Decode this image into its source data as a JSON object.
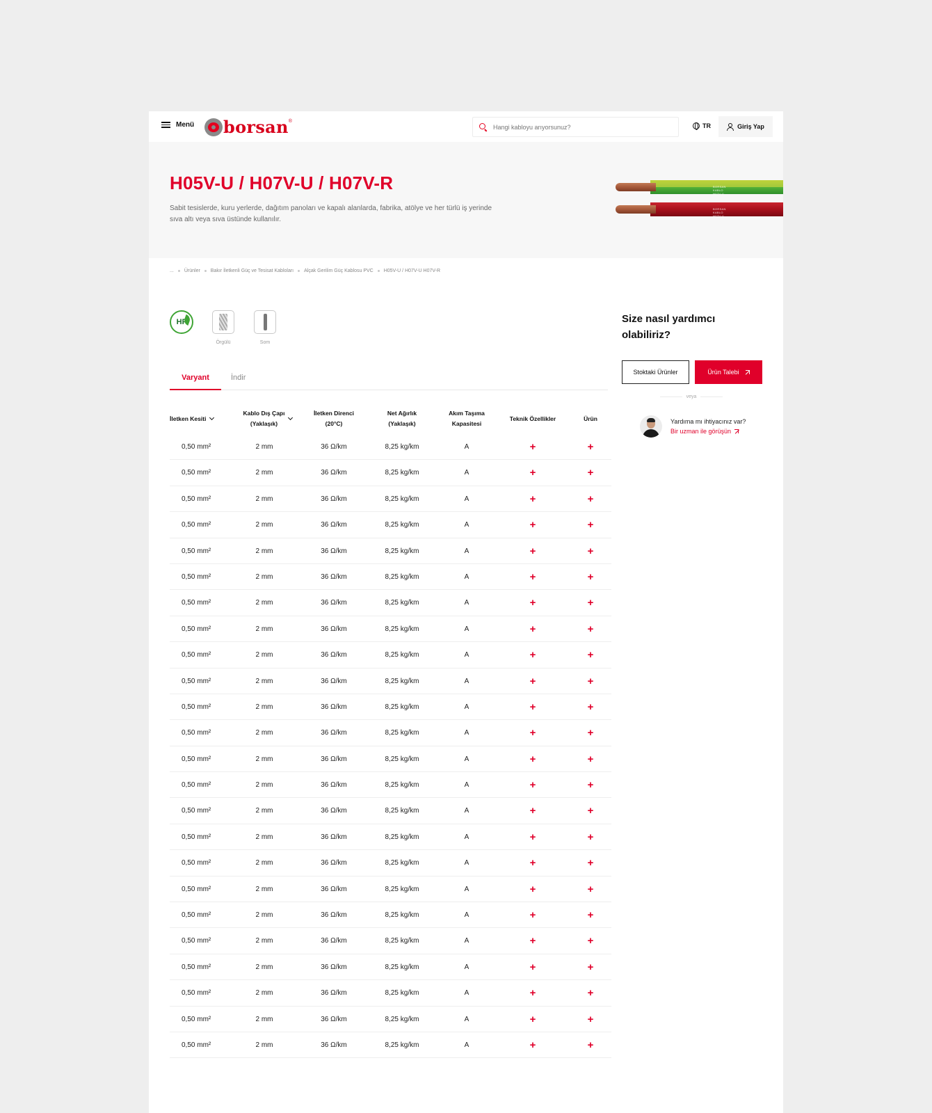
{
  "header": {
    "menu_label": "Menü",
    "logo_text": "borsan",
    "logo_reg": "®",
    "search_placeholder": "Hangi kabloyu arıyorsunuz?",
    "lang": "TR",
    "login_label": "Giriş Yap"
  },
  "hero": {
    "title": "H05V-U / H07V-U / H07V-R",
    "description": "Sabit tesislerde, kuru yerlerde, dağıtım panoları ve kapalı alanlarda, fabrika, atölye ve her türlü iş yerinde sıva altı veya sıva üstünde kullanılır.",
    "cable_print": "BORSAN KABLO  H07V-U"
  },
  "breadcrumb": [
    "...",
    "Ürünler",
    "Bakır İletkenli Güç ve Tesisat Kabloları",
    "Alçak Gerilim Güç Kablosu PVC",
    "H05V-U / H07V-U H07V-R"
  ],
  "features": {
    "hf": "HF",
    "items": [
      {
        "label": "Örgülü"
      },
      {
        "label": "Som"
      }
    ]
  },
  "tabs": [
    {
      "label": "Varyant",
      "active": true
    },
    {
      "label": "İndir",
      "active": false
    }
  ],
  "table": {
    "headers": {
      "c1": "İletken Kesiti",
      "c2a": "Kablo Dış Çapı",
      "c2b": "(Yaklaşık)",
      "c3a": "İletken Direnci",
      "c3b": "(20°C)",
      "c4a": "Net Ağırlık",
      "c4b": "(Yaklaşık)",
      "c5a": "Akım Taşıma",
      "c5b": "Kapasitesi",
      "c6": "Teknik Özellikler",
      "c7": "Ürün"
    },
    "row": {
      "kesit": "0,50 mm²",
      "cap": "2 mm",
      "direnc": "36 Ω/km",
      "agirlik": "8,25 kg/km",
      "akim": "A",
      "plus": "+"
    },
    "row_count": 24
  },
  "sidebar": {
    "title": "Size nasıl yardımcı olabiliriz?",
    "stock_button": "Stoktaki Ürünler",
    "request_button": "Ürün Talebi",
    "or": "veya",
    "help_question": "Yardıma mı ihtiyacınız var?",
    "help_link": "Bir uzman ile görüşün"
  },
  "colors": {
    "accent": "#e0002a",
    "background": "#eeeeee"
  }
}
